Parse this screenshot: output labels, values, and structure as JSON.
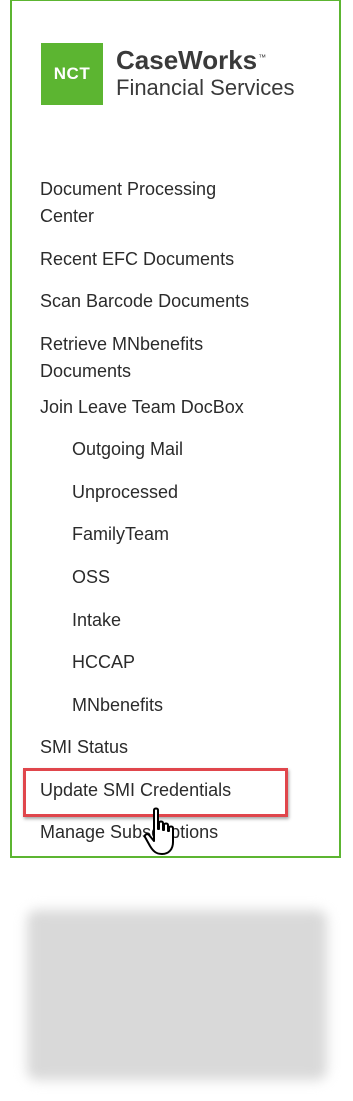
{
  "logo": {
    "badge": "NCT",
    "name": "CaseWorks",
    "trademark": "™",
    "subtitle": "Financial Services"
  },
  "nav": {
    "items": [
      {
        "label": "Document Processing",
        "label_line2": "Center"
      },
      {
        "label": "Recent EFC Documents"
      },
      {
        "label": "Scan Barcode Documents"
      },
      {
        "label": "Retrieve MNbenefits",
        "label_line2": "Documents"
      },
      {
        "label": "Join Leave Team DocBox"
      },
      {
        "label": "Outgoing Mail"
      },
      {
        "label": "Unprocessed"
      },
      {
        "label": "FamilyTeam"
      },
      {
        "label": "OSS"
      },
      {
        "label": "Intake"
      },
      {
        "label": "HCCAP"
      },
      {
        "label": "MNbenefits"
      },
      {
        "label": "SMI Status"
      },
      {
        "label": "Update SMI Credentials"
      },
      {
        "label": "Manage Subscriptions"
      }
    ]
  },
  "colors": {
    "brand_green": "#5cb531",
    "highlight_red": "#e0464c",
    "text": "#2b2b2b"
  },
  "icons": {
    "cursor": "hand-pointer-icon"
  }
}
